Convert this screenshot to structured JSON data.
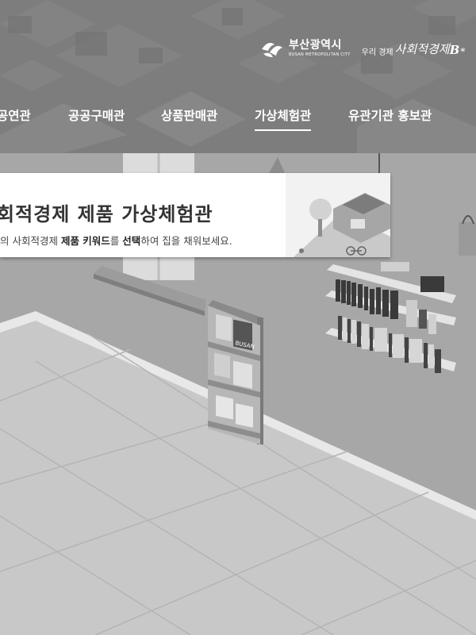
{
  "header": {
    "logo_busan": {
      "name": "부산광역시",
      "sub": "BUSAN METROPOLITAN CITY"
    },
    "logo_social": {
      "small": "우리 경제",
      "main": "사회적경제",
      "mark": "B",
      "star": "*"
    }
  },
  "nav": {
    "items": [
      {
        "label": "공연관"
      },
      {
        "label": "공공구매관"
      },
      {
        "label": "상품판매관"
      },
      {
        "label": "가상체험관"
      },
      {
        "label": "유관기관 홍보관"
      }
    ],
    "active_index": 3
  },
  "banner": {
    "title": "회적경제 제품 가상체험관",
    "subtitle_parts": [
      "의 사회적경제 ",
      "제품 키워드",
      "를 ",
      "선택",
      "하여 집을 채워보세요."
    ]
  },
  "shelf": {
    "book_label": "BUSAN"
  },
  "colors": {
    "header_bg": "#808080",
    "wall": "#a9a9a9",
    "floor": "#c9c9c9",
    "banner_bg": "#ffffff",
    "text_dark": "#333333"
  }
}
